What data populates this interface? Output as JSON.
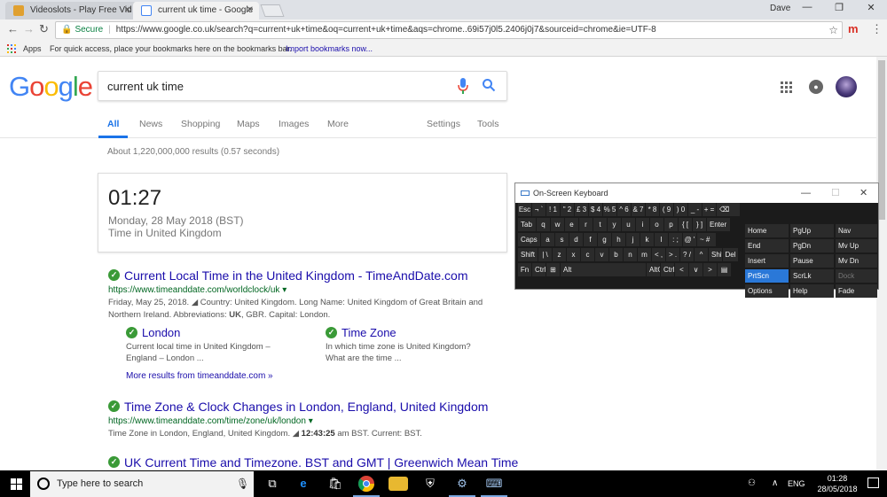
{
  "browser": {
    "tabs": [
      {
        "label": "Videoslots - Play Free Vid",
        "active": false
      },
      {
        "label": "current uk time - Google",
        "active": true
      }
    ],
    "window_user": "Dave",
    "address": {
      "secure_label": "Secure",
      "url": "https://www.google.co.uk/search?q=current+uk+time&oq=current+uk+time&aqs=chrome..69i57j0l5.2406j0j7&sourceid=chrome&ie=UTF-8"
    },
    "bookmarks": {
      "apps_label": "Apps",
      "hint": "For quick access, place your bookmarks here on the bookmarks bar.",
      "import_link": "Import bookmarks now..."
    }
  },
  "google": {
    "logo": [
      "G",
      "o",
      "o",
      "g",
      "l",
      "e"
    ],
    "logo_colors": [
      "#4285f4",
      "#ea4335",
      "#fbbc05",
      "#4285f4",
      "#34a853",
      "#ea4335"
    ],
    "query": "current uk time",
    "tabs": [
      "All",
      "News",
      "Shopping",
      "Maps",
      "Images",
      "More",
      "Settings",
      "Tools"
    ],
    "stats": "About 1,220,000,000 results (0.57 seconds)",
    "time_card": {
      "time": "01:27",
      "date": "Monday, 28 May 2018 (BST)",
      "location": "Time in United Kingdom"
    },
    "results": [
      {
        "title": "Current Local Time in the United Kingdom - TimeAndDate.com",
        "url": "https://www.timeanddate.com/worldclock/uk",
        "snippet_prefix": "Friday, May 25, 2018. ◢ Country: United Kingdom. Long Name: United Kingdom of Great Britain and Northern Ireland. Abbreviations: ",
        "snippet_bold1": "UK",
        "snippet_mid": ", GBR. Capital: London."
      },
      {
        "title": "Time Zone & Clock Changes in London, England, United Kingdom",
        "url": "https://www.timeanddate.com/time/zone/uk/london",
        "snippet_prefix": "Time Zone in London, England, United Kingdom. ◢ ",
        "snippet_bold1": "12:43:25",
        "snippet_mid": " am BST. Current: BST."
      },
      {
        "title": "UK Current Time and Timezone. BST and GMT | Greenwich Mean Time"
      }
    ],
    "sitelinks": [
      {
        "title": "London",
        "snippet": "Current local time in United Kingdom – England – London ..."
      },
      {
        "title": "Time Zone",
        "snippet": "In which time zone is United Kingdom? What are the time ..."
      }
    ],
    "more_results": "More results from timeanddate.com »"
  },
  "osk": {
    "title": "On-Screen Keyboard",
    "row1": [
      "Esc",
      "¬ `",
      "! 1",
      "\" 2",
      "£ 3",
      "$ 4",
      "% 5",
      "^ 6",
      "& 7",
      "* 8",
      "( 9",
      ") 0",
      "_ -",
      "+ =",
      "⌫"
    ],
    "row2": [
      "Tab",
      "q",
      "w",
      "e",
      "r",
      "t",
      "y",
      "u",
      "i",
      "o",
      "p",
      "{ [",
      "} ]",
      "Enter"
    ],
    "row3": [
      "Caps",
      "a",
      "s",
      "d",
      "f",
      "g",
      "h",
      "j",
      "k",
      "l",
      ": ;",
      "@ '",
      "~ #"
    ],
    "row4": [
      "Shift",
      "| \\",
      "z",
      "x",
      "c",
      "v",
      "b",
      "n",
      "m",
      "< ,",
      "> .",
      "? /",
      "^",
      "Shift",
      "Del"
    ],
    "row5": [
      "Fn",
      "Ctrl",
      "⊞",
      "Alt",
      "AltGr",
      "Ctrl",
      "<",
      "∨",
      ">",
      "▤"
    ],
    "nav_keys": [
      "Home",
      "PgUp",
      "Nav",
      "End",
      "PgDn",
      "Mv Up",
      "Insert",
      "Pause",
      "Mv Dn",
      "PrtScn",
      "ScrLk",
      "Dock",
      "Options",
      "Help",
      "Fade"
    ]
  },
  "taskbar": {
    "search_placeholder": "Type here to search",
    "language": "ENG",
    "time": "01:28",
    "date": "28/05/2018"
  }
}
